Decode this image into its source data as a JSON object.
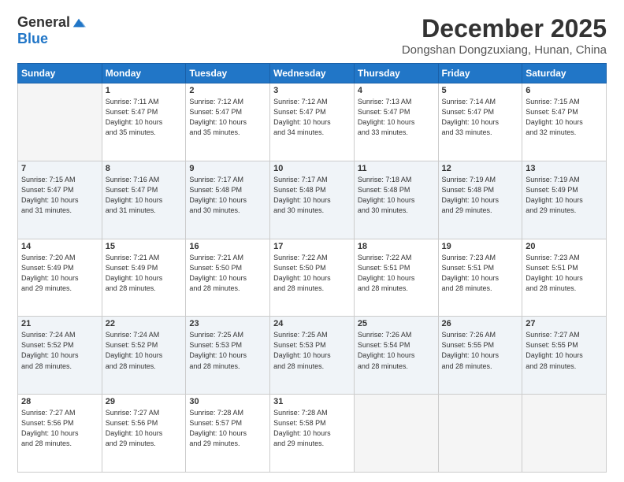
{
  "header": {
    "logo_general": "General",
    "logo_blue": "Blue",
    "month_title": "December 2025",
    "subtitle": "Dongshan Dongzuxiang, Hunan, China"
  },
  "days_of_week": [
    "Sunday",
    "Monday",
    "Tuesday",
    "Wednesday",
    "Thursday",
    "Friday",
    "Saturday"
  ],
  "weeks": [
    [
      {
        "day": "",
        "info": ""
      },
      {
        "day": "1",
        "info": "Sunrise: 7:11 AM\nSunset: 5:47 PM\nDaylight: 10 hours\nand 35 minutes."
      },
      {
        "day": "2",
        "info": "Sunrise: 7:12 AM\nSunset: 5:47 PM\nDaylight: 10 hours\nand 35 minutes."
      },
      {
        "day": "3",
        "info": "Sunrise: 7:12 AM\nSunset: 5:47 PM\nDaylight: 10 hours\nand 34 minutes."
      },
      {
        "day": "4",
        "info": "Sunrise: 7:13 AM\nSunset: 5:47 PM\nDaylight: 10 hours\nand 33 minutes."
      },
      {
        "day": "5",
        "info": "Sunrise: 7:14 AM\nSunset: 5:47 PM\nDaylight: 10 hours\nand 33 minutes."
      },
      {
        "day": "6",
        "info": "Sunrise: 7:15 AM\nSunset: 5:47 PM\nDaylight: 10 hours\nand 32 minutes."
      }
    ],
    [
      {
        "day": "7",
        "info": "Sunrise: 7:15 AM\nSunset: 5:47 PM\nDaylight: 10 hours\nand 31 minutes."
      },
      {
        "day": "8",
        "info": "Sunrise: 7:16 AM\nSunset: 5:47 PM\nDaylight: 10 hours\nand 31 minutes."
      },
      {
        "day": "9",
        "info": "Sunrise: 7:17 AM\nSunset: 5:48 PM\nDaylight: 10 hours\nand 30 minutes."
      },
      {
        "day": "10",
        "info": "Sunrise: 7:17 AM\nSunset: 5:48 PM\nDaylight: 10 hours\nand 30 minutes."
      },
      {
        "day": "11",
        "info": "Sunrise: 7:18 AM\nSunset: 5:48 PM\nDaylight: 10 hours\nand 30 minutes."
      },
      {
        "day": "12",
        "info": "Sunrise: 7:19 AM\nSunset: 5:48 PM\nDaylight: 10 hours\nand 29 minutes."
      },
      {
        "day": "13",
        "info": "Sunrise: 7:19 AM\nSunset: 5:49 PM\nDaylight: 10 hours\nand 29 minutes."
      }
    ],
    [
      {
        "day": "14",
        "info": "Sunrise: 7:20 AM\nSunset: 5:49 PM\nDaylight: 10 hours\nand 29 minutes."
      },
      {
        "day": "15",
        "info": "Sunrise: 7:21 AM\nSunset: 5:49 PM\nDaylight: 10 hours\nand 28 minutes."
      },
      {
        "day": "16",
        "info": "Sunrise: 7:21 AM\nSunset: 5:50 PM\nDaylight: 10 hours\nand 28 minutes."
      },
      {
        "day": "17",
        "info": "Sunrise: 7:22 AM\nSunset: 5:50 PM\nDaylight: 10 hours\nand 28 minutes."
      },
      {
        "day": "18",
        "info": "Sunrise: 7:22 AM\nSunset: 5:51 PM\nDaylight: 10 hours\nand 28 minutes."
      },
      {
        "day": "19",
        "info": "Sunrise: 7:23 AM\nSunset: 5:51 PM\nDaylight: 10 hours\nand 28 minutes."
      },
      {
        "day": "20",
        "info": "Sunrise: 7:23 AM\nSunset: 5:51 PM\nDaylight: 10 hours\nand 28 minutes."
      }
    ],
    [
      {
        "day": "21",
        "info": "Sunrise: 7:24 AM\nSunset: 5:52 PM\nDaylight: 10 hours\nand 28 minutes."
      },
      {
        "day": "22",
        "info": "Sunrise: 7:24 AM\nSunset: 5:52 PM\nDaylight: 10 hours\nand 28 minutes."
      },
      {
        "day": "23",
        "info": "Sunrise: 7:25 AM\nSunset: 5:53 PM\nDaylight: 10 hours\nand 28 minutes."
      },
      {
        "day": "24",
        "info": "Sunrise: 7:25 AM\nSunset: 5:53 PM\nDaylight: 10 hours\nand 28 minutes."
      },
      {
        "day": "25",
        "info": "Sunrise: 7:26 AM\nSunset: 5:54 PM\nDaylight: 10 hours\nand 28 minutes."
      },
      {
        "day": "26",
        "info": "Sunrise: 7:26 AM\nSunset: 5:55 PM\nDaylight: 10 hours\nand 28 minutes."
      },
      {
        "day": "27",
        "info": "Sunrise: 7:27 AM\nSunset: 5:55 PM\nDaylight: 10 hours\nand 28 minutes."
      }
    ],
    [
      {
        "day": "28",
        "info": "Sunrise: 7:27 AM\nSunset: 5:56 PM\nDaylight: 10 hours\nand 28 minutes."
      },
      {
        "day": "29",
        "info": "Sunrise: 7:27 AM\nSunset: 5:56 PM\nDaylight: 10 hours\nand 29 minutes."
      },
      {
        "day": "30",
        "info": "Sunrise: 7:28 AM\nSunset: 5:57 PM\nDaylight: 10 hours\nand 29 minutes."
      },
      {
        "day": "31",
        "info": "Sunrise: 7:28 AM\nSunset: 5:58 PM\nDaylight: 10 hours\nand 29 minutes."
      },
      {
        "day": "",
        "info": ""
      },
      {
        "day": "",
        "info": ""
      },
      {
        "day": "",
        "info": ""
      }
    ]
  ]
}
